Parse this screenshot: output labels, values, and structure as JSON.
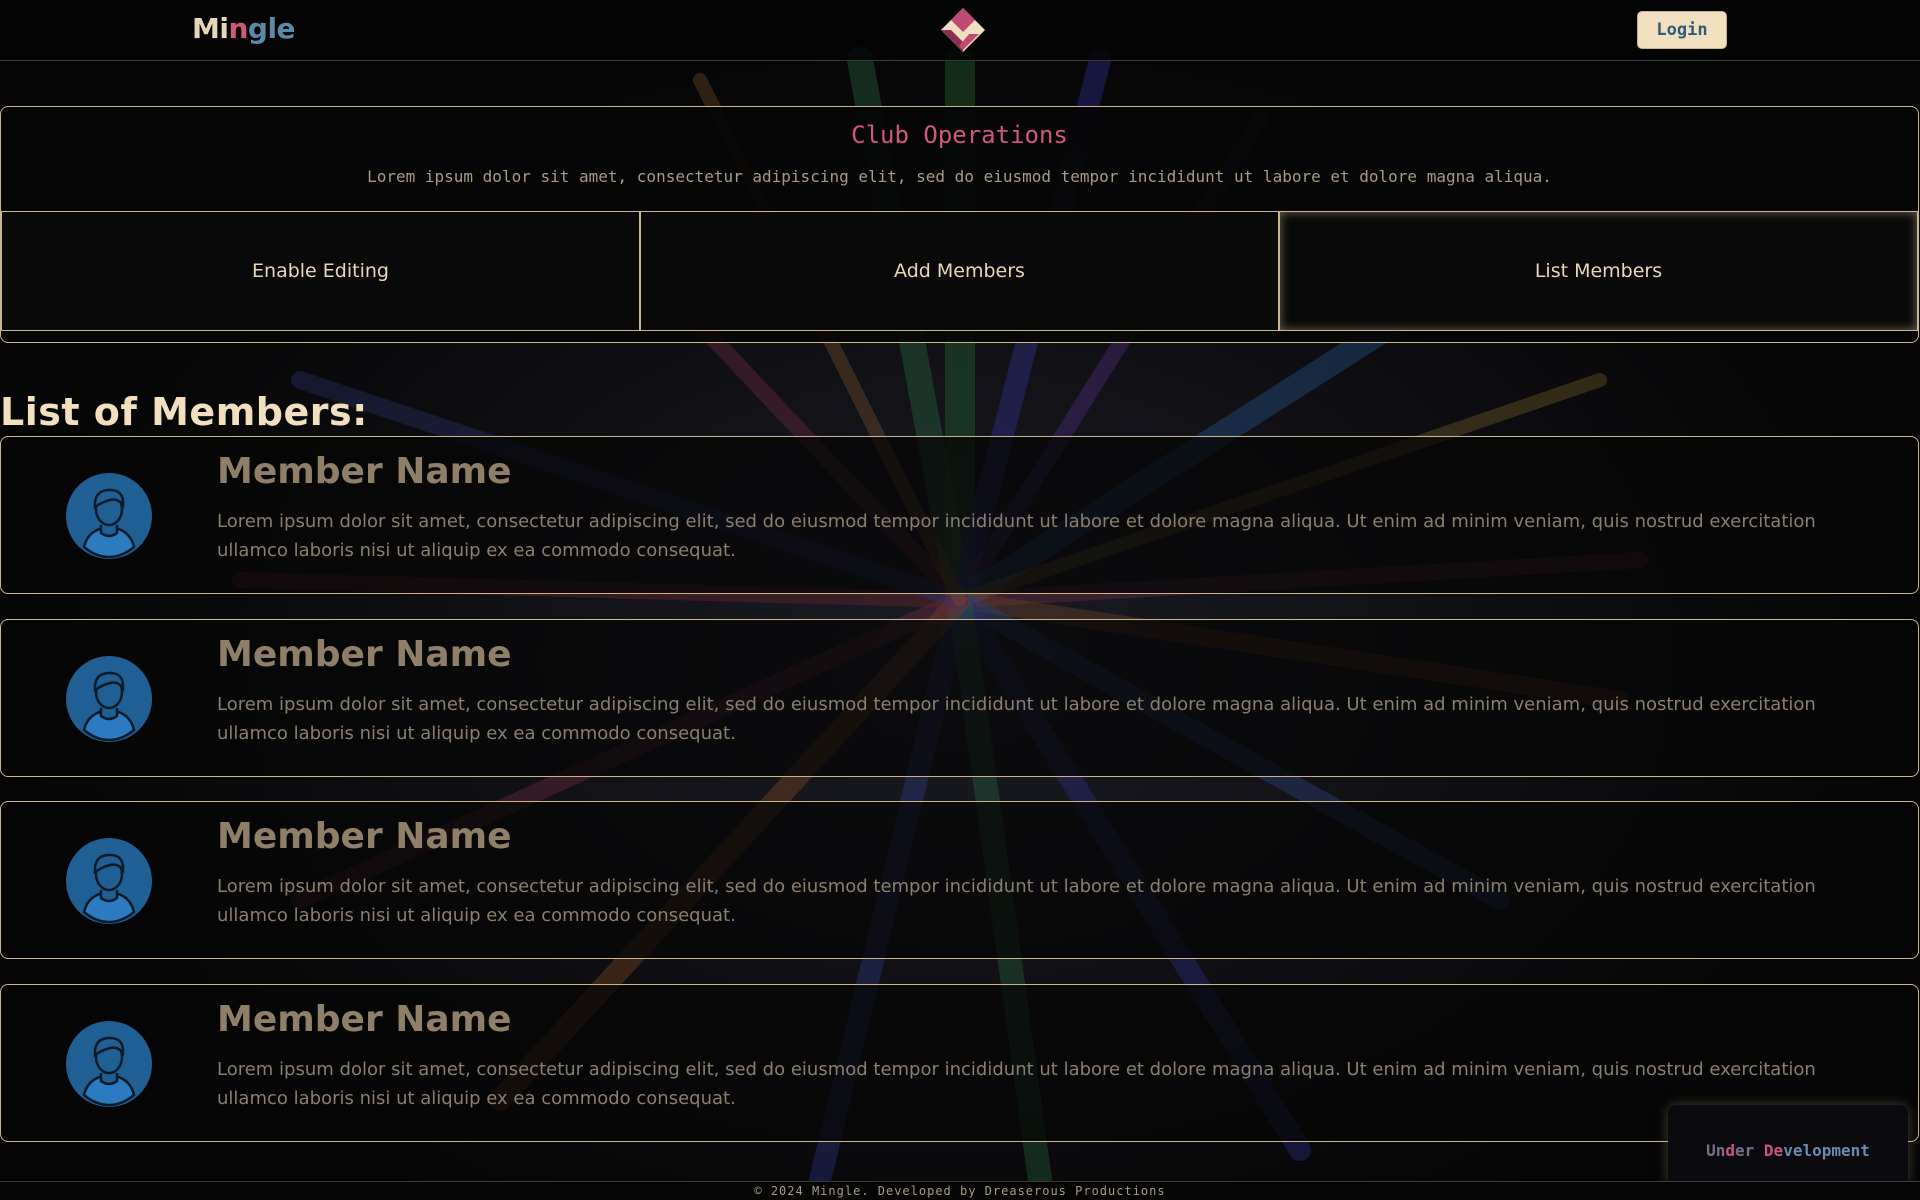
{
  "header": {
    "logo_parts": [
      "Mi",
      "n",
      "gle"
    ],
    "login_label": "Login"
  },
  "operations": {
    "title": "Club Operations",
    "subtitle": "Lorem ipsum dolor sit amet, consectetur adipiscing elit, sed do eiusmod tempor incididunt ut labore et dolore magna aliqua.",
    "buttons": [
      {
        "label": "Enable Editing"
      },
      {
        "label": "Add Members"
      },
      {
        "label": "List Members"
      }
    ]
  },
  "members": {
    "heading": "List of Members:",
    "items": [
      {
        "name": "Member Name",
        "description": "Lorem ipsum dolor sit amet, consectetur adipiscing elit, sed do eiusmod tempor incididunt ut labore et dolore magna aliqua. Ut enim ad minim veniam, quis nostrud exercitation ullamco laboris nisi ut aliquip ex ea commodo consequat."
      },
      {
        "name": "Member Name",
        "description": "Lorem ipsum dolor sit amet, consectetur adipiscing elit, sed do eiusmod tempor incididunt ut labore et dolore magna aliqua. Ut enim ad minim veniam, quis nostrud exercitation ullamco laboris nisi ut aliquip ex ea commodo consequat."
      },
      {
        "name": "Member Name",
        "description": "Lorem ipsum dolor sit amet, consectetur adipiscing elit, sed do eiusmod tempor incididunt ut labore et dolore magna aliqua. Ut enim ad minim veniam, quis nostrud exercitation ullamco laboris nisi ut aliquip ex ea commodo consequat."
      },
      {
        "name": "Member Name",
        "description": "Lorem ipsum dolor sit amet, consectetur adipiscing elit, sed do eiusmod tempor incididunt ut labore et dolore magna aliqua. Ut enim ad minim veniam, quis nostrud exercitation ullamco laboris nisi ut aliquip ex ea commodo consequat."
      }
    ]
  },
  "badge": {
    "parts": [
      "Un",
      "d",
      "er ",
      "De",
      "velopment"
    ]
  },
  "footer": {
    "text": "© 2024 Mingle. Developed by Dreaserous Productions"
  },
  "colors": {
    "accent_cream": "#f1dfc0",
    "accent_pink": "#d0587a",
    "accent_blue": "#5a8aa8",
    "avatar_blue": "#1f5f94",
    "border": "#c9b48e",
    "background": "#050505"
  },
  "icons": {
    "logo": "diamond-logo-icon",
    "avatar": "user-avatar-icon"
  }
}
